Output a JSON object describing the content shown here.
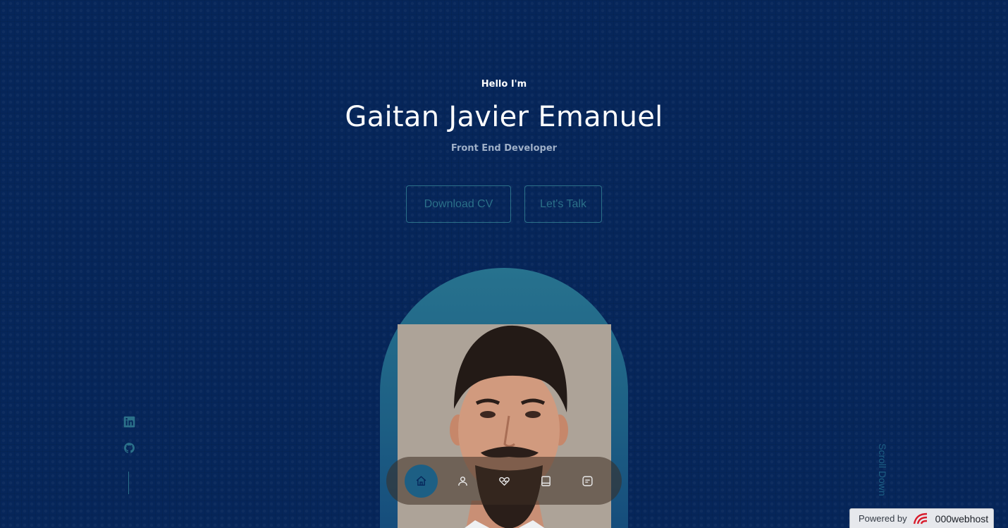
{
  "hero": {
    "greeting": "Hello I'm",
    "name": "Gaitan Javier Emanuel",
    "role": "Front End Developer"
  },
  "buttons": {
    "download_cv": "Download CV",
    "lets_talk": "Let's Talk"
  },
  "socials": [
    {
      "icon": "linkedin-icon"
    },
    {
      "icon": "github-icon"
    }
  ],
  "scroll_down": "Scroll Down",
  "nav": [
    {
      "icon": "home-icon",
      "active": true
    },
    {
      "icon": "user-icon",
      "active": false
    },
    {
      "icon": "skills-icon",
      "active": false
    },
    {
      "icon": "book-icon",
      "active": false
    },
    {
      "icon": "message-icon",
      "active": false
    }
  ],
  "footer_badge": {
    "prefix": "Powered by",
    "brand": "000webhost"
  },
  "colors": {
    "background": "#06265a",
    "accent": "#2b7089",
    "arch": "#1d5f84"
  }
}
